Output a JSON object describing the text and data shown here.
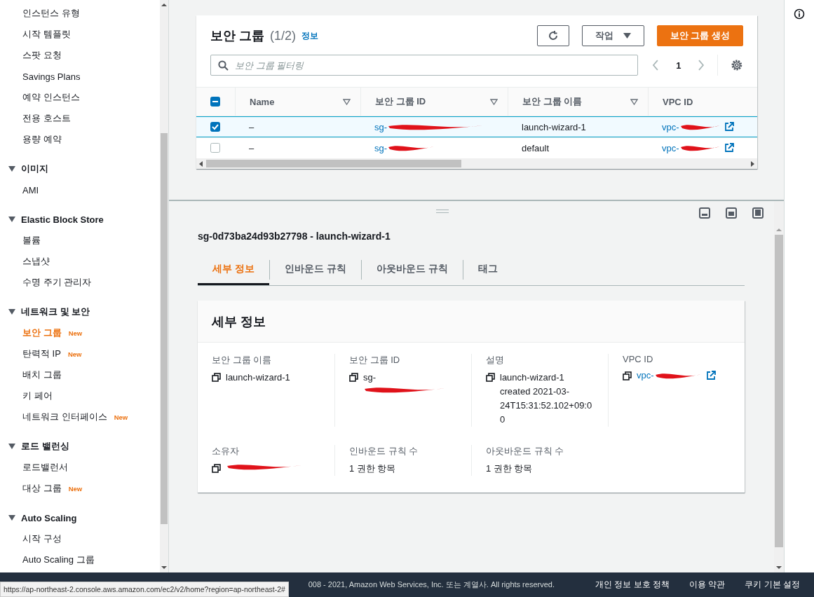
{
  "sidebar": {
    "sections": [
      {
        "items": [
          {
            "label": "인스턴스 유형",
            "selected": false
          },
          {
            "label": "시작 템플릿",
            "selected": false
          },
          {
            "label": "스팟 요청",
            "selected": false
          },
          {
            "label": "Savings Plans",
            "selected": false
          },
          {
            "label": "예약 인스턴스",
            "selected": false
          },
          {
            "label": "전용 호스트",
            "selected": false
          },
          {
            "label": "용량 예약",
            "selected": false
          }
        ]
      },
      {
        "title": "이미지",
        "expanded": true,
        "items": [
          {
            "label": "AMI",
            "selected": false
          }
        ]
      },
      {
        "title": "Elastic Block Store",
        "expanded": true,
        "items": [
          {
            "label": "볼륨",
            "selected": false
          },
          {
            "label": "스냅샷",
            "selected": false
          },
          {
            "label": "수명 주기 관리자",
            "selected": false
          }
        ]
      },
      {
        "title": "네트워크 및 보안",
        "expanded": true,
        "items": [
          {
            "label": "보안 그룹",
            "selected": true,
            "badge": "New"
          },
          {
            "label": "탄력적 IP",
            "selected": false,
            "badge": "New"
          },
          {
            "label": "배치 그룹",
            "selected": false
          },
          {
            "label": "키 페어",
            "selected": false
          },
          {
            "label": "네트워크 인터페이스",
            "selected": false,
            "badge": "New"
          }
        ]
      },
      {
        "title": "로드 밸런싱",
        "expanded": true,
        "items": [
          {
            "label": "로드밸런서",
            "selected": false
          },
          {
            "label": "대상 그룹",
            "selected": false,
            "badge": "New"
          }
        ]
      },
      {
        "title": "Auto Scaling",
        "expanded": true,
        "items": [
          {
            "label": "시작 구성",
            "selected": false
          },
          {
            "label": "Auto Scaling 그룹",
            "selected": false
          }
        ]
      }
    ]
  },
  "security_groups": {
    "title": "보안 그룹",
    "count": "(1/2)",
    "info_link": "정보",
    "actions_label": "작업",
    "create_label": "보안 그룹 생성",
    "filter_placeholder": "보안 그룹 필터링",
    "page": "1",
    "select_all_partial": true,
    "columns": [
      "Name",
      "보안 그룹 ID",
      "보안 그룹 이름",
      "VPC ID"
    ],
    "rows": [
      {
        "selected": true,
        "name": "–",
        "group_id": "sg-",
        "group_name": "launch-wizard-1",
        "vpc_id": "vpc-"
      },
      {
        "selected": false,
        "name": "–",
        "group_id": "sg-",
        "group_name": "default",
        "vpc_id": "vpc-"
      }
    ]
  },
  "detail": {
    "title": "sg-0d73ba24d93b27798 - launch-wizard-1",
    "tabs": [
      {
        "label": "세부 정보",
        "selected": true
      },
      {
        "label": "인바운드 규칙",
        "selected": false
      },
      {
        "label": "아웃바운드 규칙",
        "selected": false
      },
      {
        "label": "태그",
        "selected": false
      }
    ],
    "card_title": "세부 정보",
    "fields": [
      {
        "label": "보안 그룹 이름",
        "kind": "copy",
        "value": "launch-wizard-1"
      },
      {
        "label": "보안 그룹 ID",
        "kind": "copy",
        "value": "sg-",
        "redacted": true
      },
      {
        "label": "설명",
        "kind": "copy",
        "value": "launch-wizard-1 created 2021-03-24T15:31:52.102+09:00"
      },
      {
        "label": "VPC ID",
        "kind": "link",
        "value": "vpc-",
        "redacted": true
      },
      {
        "label": "소유자",
        "kind": "copy",
        "redacted": true
      },
      {
        "label": "인바운드 규칙 수",
        "kind": "plain",
        "value": "1 권한 항목"
      },
      {
        "label": "아웃바운드 규칙 수",
        "kind": "plain",
        "value": "1 권한 항목"
      }
    ]
  },
  "footer": {
    "copyright": "008 - 2021, Amazon Web Services, Inc. 또는 계열사. All rights reserved.",
    "links": [
      "개인 정보 보호 정책",
      "이용 약관",
      "쿠키 기본 설정"
    ]
  },
  "status_url": "https://ap-northeast-2.console.aws.amazon.com/ec2/v2/home?region=ap-northeast-2#"
}
